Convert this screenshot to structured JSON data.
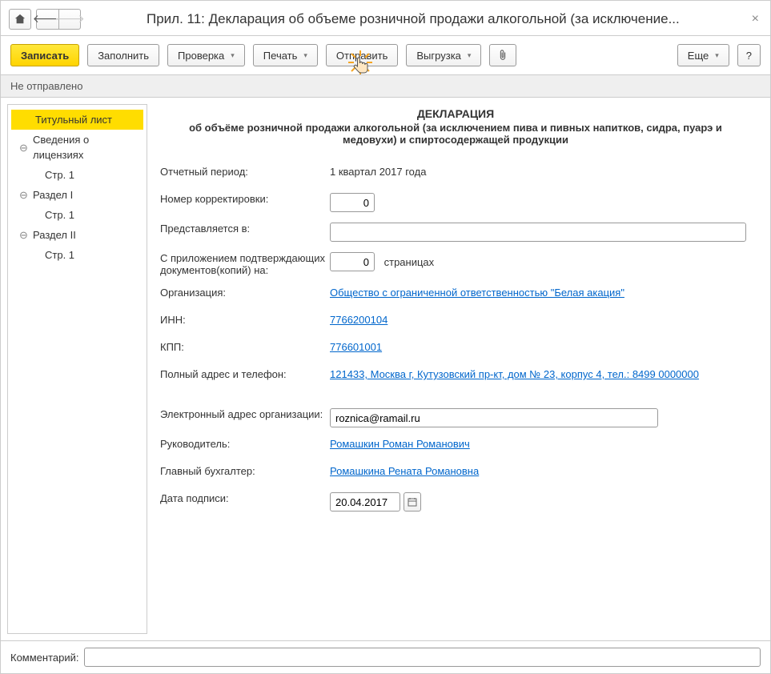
{
  "window": {
    "title": "Прил. 11: Декларация об объеме розничной продажи алкогольной (за исключение..."
  },
  "toolbar": {
    "save": "Записать",
    "fill": "Заполнить",
    "check": "Проверка",
    "print": "Печать",
    "send": "Отправить",
    "export": "Выгрузка",
    "more": "Еще",
    "help": "?"
  },
  "status": "Не отправлено",
  "sidebar": {
    "items": [
      {
        "label": "Титульный лист"
      },
      {
        "label": "Сведения о лицензиях"
      },
      {
        "label": "Стр. 1"
      },
      {
        "label": "Раздел I"
      },
      {
        "label": "Стр. 1"
      },
      {
        "label": "Раздел II"
      },
      {
        "label": "Стр. 1"
      }
    ]
  },
  "doc": {
    "heading": "ДЕКЛАРАЦИЯ",
    "sub": "об объёме розничной продажи алкогольной (за исключением пива и пивных напитков, сидра, пуарэ и медовухи) и спиртосодержащей продукции"
  },
  "form": {
    "period_label": "Отчетный период:",
    "period_value": "1 квартал 2017 года",
    "corr_label": "Номер корректировки:",
    "corr_value": "0",
    "submit_to_label": "Представляется в:",
    "submit_to_value": "",
    "attach_label": "С приложением подтверждающих документов(копий) на:",
    "attach_value": "0",
    "attach_suffix": "страницах",
    "org_label": "Организация:",
    "org_value": "Общество с ограниченной ответственностью \"Белая акация\"",
    "inn_label": "ИНН:",
    "inn_value": "7766200104",
    "kpp_label": "КПП:",
    "kpp_value": "776601001",
    "addr_label": "Полный адрес и телефон:",
    "addr_value": "121433, Москва г, Кутузовский пр-кт, дом № 23, корпус 4, тел.: 8499 0000000",
    "email_label": "Электронный адрес организации:",
    "email_value": "roznica@ramail.ru",
    "head_label": "Руководитель:",
    "head_value": "Ромашкин Роман Романович",
    "acct_label": "Главный бухгалтер:",
    "acct_value": "Ромашкина Рената Романовна",
    "sign_date_label": "Дата подписи:",
    "sign_date_value": "20.04.2017"
  },
  "footer": {
    "comment_label": "Комментарий:",
    "comment_value": ""
  }
}
